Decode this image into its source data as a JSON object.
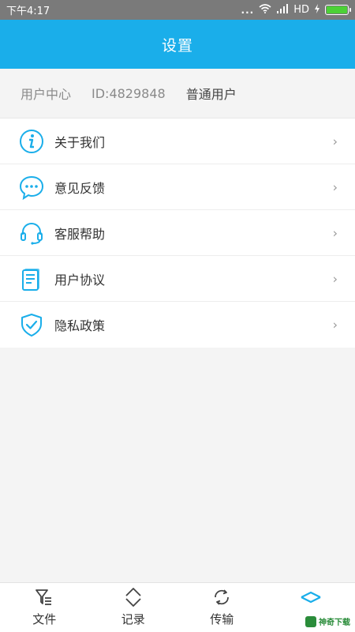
{
  "status_bar": {
    "time": "下午4:17",
    "dots": "...",
    "network": "HD"
  },
  "app_bar": {
    "title": "设置"
  },
  "user_info": {
    "center_label": "用户中心",
    "user_id": "ID:4829848",
    "user_type": "普通用户"
  },
  "menu": {
    "items": [
      {
        "label": "关于我们",
        "icon": "info-icon"
      },
      {
        "label": "意见反馈",
        "icon": "chat-bubble-icon"
      },
      {
        "label": "客服帮助",
        "icon": "headset-icon"
      },
      {
        "label": "用户协议",
        "icon": "document-icon"
      },
      {
        "label": "隐私政策",
        "icon": "shield-check-icon"
      }
    ],
    "arrow": "›"
  },
  "bottom_nav": {
    "tabs": [
      {
        "label": "文件",
        "icon": "file-filter-icon"
      },
      {
        "label": "记录",
        "icon": "up-down-chevron-icon"
      },
      {
        "label": "传输",
        "icon": "sync-icon"
      },
      {
        "label": "",
        "icon": "settings-chevron-icon"
      }
    ]
  },
  "watermark": {
    "text": "神奇下载"
  },
  "colors": {
    "accent": "#1aaeea",
    "status_bar": "#7a7a7a",
    "battery": "#4cd137"
  }
}
